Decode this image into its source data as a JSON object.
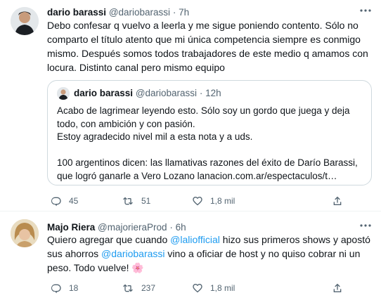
{
  "tweets": [
    {
      "author": "dario barassi",
      "handle": "@dariobarassi",
      "separator": "·",
      "time": "7h",
      "text": "Debo confesar q vuelvo a leerla y me sigue poniendo contento. Sólo no comparto el título atento que mi única competencia siempre es conmigo mismo. Después somos todos trabajadores de este medio q amamos con locura. Distinto canal pero mismo equipo",
      "quote": {
        "author": "dario barassi",
        "handle": "@dariobarassi",
        "separator": "·",
        "time": "12h",
        "paragraph1": "Acabo de lagrimear leyendo esto. Sólo soy un gordo que juega y deja todo, con ambición y con pasión.",
        "paragraph2": "Estoy agradecido nivel mil a esta nota y a uds.",
        "paragraph3": "100 argentinos dicen: las llamativas razones del éxito de Darío Barassi, que logró ganarle a Vero Lozano lanacion.com.ar/espectaculos/t…"
      },
      "actions": {
        "replies": "45",
        "retweets": "51",
        "likes": "1,8 mil"
      }
    },
    {
      "author": "Majo Riera",
      "handle": "@majorieraProd",
      "separator": "·",
      "time": "6h",
      "text_part1": "Quiero agregar que cuando ",
      "mention1": "@laliofficial",
      "text_part2": " hizo sus primeros shows y apostó sus ahorros ",
      "mention2": "@dariobarassi",
      "text_part3": " vino a oficiar de host y no quiso cobrar ni un peso. Todo vuelve! ",
      "emoji": "🌸",
      "actions": {
        "replies": "18",
        "retweets": "237",
        "likes": "1,8 mil"
      }
    }
  ],
  "icons": {
    "reply": "reply-icon",
    "retweet": "retweet-icon",
    "like": "heart-icon",
    "share": "share-icon",
    "more": "more-icon"
  },
  "colors": {
    "text": "#0f1419",
    "secondary": "#536471",
    "accent": "#1d9bf0",
    "border": "#cfd9de"
  }
}
